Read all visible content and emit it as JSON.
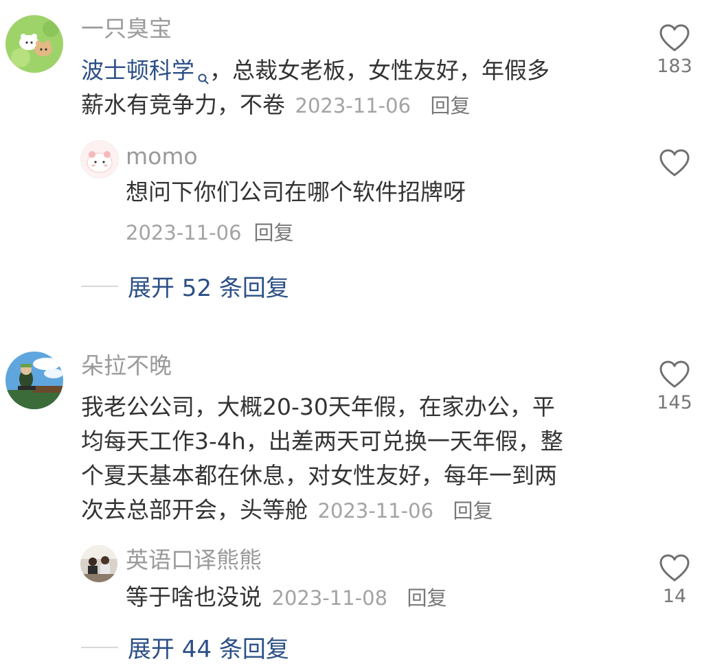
{
  "comments": [
    {
      "name": "一只臭宝",
      "link_text": "波士顿科学",
      "line1_rest": "，总裁女老板，女性友好，年假多",
      "line2": "薪水有竞争力，不卷",
      "date": "2023-11-06",
      "reply_label": "回复",
      "likes": "183",
      "replies": [
        {
          "name": "momo",
          "text": "想问下你们公司在哪个软件招牌呀",
          "date": "2023-11-06",
          "reply_label": "回复"
        }
      ],
      "expand_label": "展开 52 条回复"
    },
    {
      "name": "朵拉不晚",
      "lines": [
        "我老公公司，大概20-30天年假，在家办公，平",
        "均每天工作3-4h，出差两天可兑换一天年假，整",
        "个夏天基本都在休息，对女性友好，每年一到两",
        "次去总部开会，头等舱"
      ],
      "date": "2023-11-06",
      "reply_label": "回复",
      "likes": "145",
      "replies": [
        {
          "name": "英语口译熊熊",
          "text": "等于啥也没说",
          "date": "2023-11-08",
          "reply_label": "回复",
          "likes": "14"
        }
      ],
      "expand_label": "展开 44 条回复"
    }
  ],
  "colors": {
    "name": "#9a9a9a",
    "body": "#333333",
    "link": "#2b4f86",
    "meta": "#a3a3a3"
  },
  "icons": [
    "heart-outline-icon",
    "search-icon"
  ]
}
